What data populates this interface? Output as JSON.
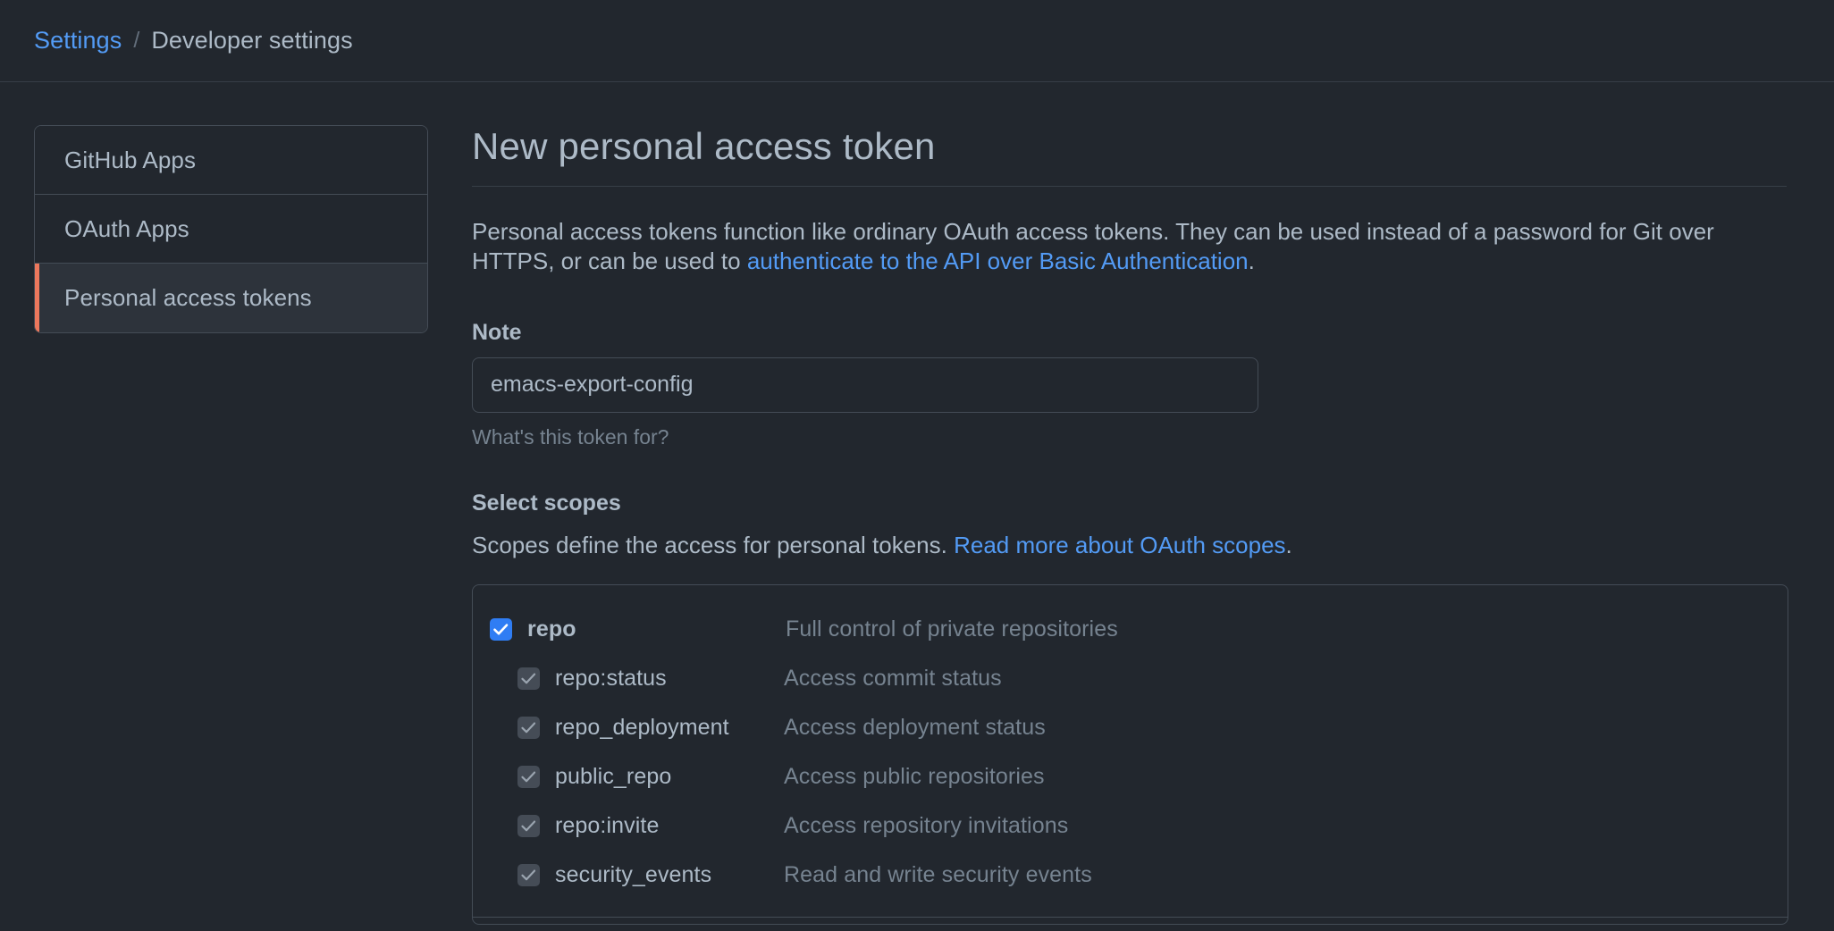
{
  "breadcrumb": {
    "root": "Settings",
    "separator": "/",
    "current": "Developer settings"
  },
  "sidebar": {
    "items": [
      {
        "label": "GitHub Apps",
        "selected": false
      },
      {
        "label": "OAuth Apps",
        "selected": false
      },
      {
        "label": "Personal access tokens",
        "selected": true
      }
    ],
    "selected_accent_color": "#ec775c"
  },
  "main": {
    "title": "New personal access token",
    "intro": {
      "before_link": "Personal access tokens function like ordinary OAuth access tokens. They can be used instead of a password for Git over HTTPS, or can be used to ",
      "link_text": "authenticate to the API over Basic Authentication",
      "after_link": "."
    },
    "note": {
      "label": "Note",
      "value": "emacs-export-config",
      "placeholder": "What's this token for?",
      "help": "What's this token for?"
    },
    "scopes": {
      "title": "Select scopes",
      "description_before_link": "Scopes define the access for personal tokens. ",
      "description_link": "Read more about OAuth scopes",
      "description_after_link": ".",
      "rows": [
        {
          "name": "repo",
          "description": "Full control of private repositories",
          "checked": true,
          "disabled": false,
          "child": false
        },
        {
          "name": "repo:status",
          "description": "Access commit status",
          "checked": true,
          "disabled": true,
          "child": true
        },
        {
          "name": "repo_deployment",
          "description": "Access deployment status",
          "checked": true,
          "disabled": true,
          "child": true
        },
        {
          "name": "public_repo",
          "description": "Access public repositories",
          "checked": true,
          "disabled": true,
          "child": true
        },
        {
          "name": "repo:invite",
          "description": "Access repository invitations",
          "checked": true,
          "disabled": true,
          "child": true
        },
        {
          "name": "security_events",
          "description": "Read and write security events",
          "checked": true,
          "disabled": true,
          "child": true
        }
      ]
    }
  },
  "colors": {
    "background": "#22272e",
    "accent_blue": "#539bf5",
    "checkbox_blue": "#2f7df4",
    "selected_accent": "#ec775c",
    "border": "#444c56",
    "text": "#adbac7",
    "muted_text": "#768390"
  }
}
